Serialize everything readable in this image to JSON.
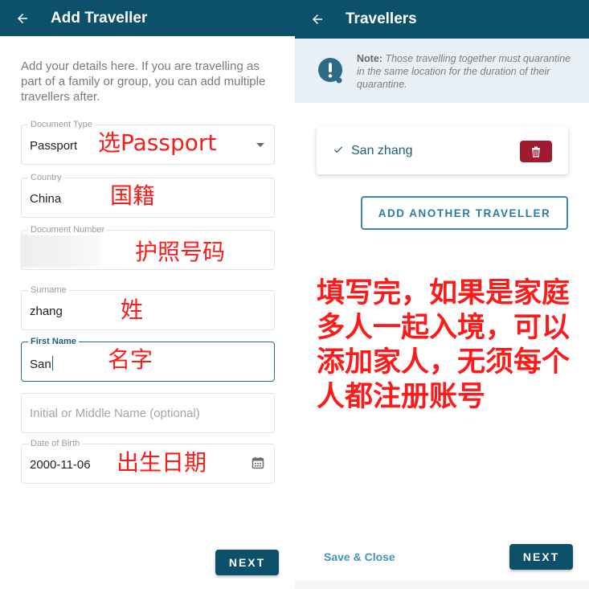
{
  "left_screen": {
    "header": {
      "title": "Add Traveller",
      "back_icon": "arrow-left-icon"
    },
    "intro": "Add your details here. If you are travelling as part of a family or group, you can add multiple travellers after.",
    "fields": {
      "document_type": {
        "label": "Document Type",
        "value": "Passport",
        "icon": "dropdown-arrow-icon"
      },
      "country": {
        "label": "Country",
        "value": "China"
      },
      "document_number": {
        "label": "Document Number",
        "value": ""
      },
      "surname": {
        "label": "Surname",
        "value": "zhang"
      },
      "first_name": {
        "label": "First Name",
        "value": "San"
      },
      "middle_name": {
        "placeholder": "Initial or Middle Name (optional)",
        "value": ""
      },
      "date_of_birth": {
        "label": "Date of Birth",
        "value": "2000-11-06",
        "icon": "calendar-icon"
      }
    },
    "annotations": {
      "document_type": "选Passport",
      "country": "国籍",
      "document_number": "护照号码",
      "surname": "姓",
      "first_name": "名字",
      "date_of_birth": "出生日期"
    },
    "next_label": "NEXT"
  },
  "right_screen": {
    "header": {
      "title": "Travellers",
      "back_icon": "arrow-left-icon"
    },
    "note": {
      "bold": "Note:",
      "text": "Those travelling together must quarantine in the same location for the duration of their quarantine.",
      "icon": "alert-info-icon"
    },
    "travellers": [
      {
        "name": "San zhang",
        "status_icon": "check-icon",
        "action_icon": "trash-icon"
      }
    ],
    "add_another_label": "ADD ANOTHER TRAVELLER",
    "annotation": "填写完，如果是家庭多人一起入境，可以添加家人，无须每个人都注册账号",
    "save_close_label": "Save & Close",
    "next_label": "NEXT"
  },
  "colors": {
    "primary": "#0d5069",
    "accent_link": "#4593bd",
    "danger": "#a21a30",
    "note_bg": "#e8f0f5",
    "annotation": "#ff1a1a"
  }
}
